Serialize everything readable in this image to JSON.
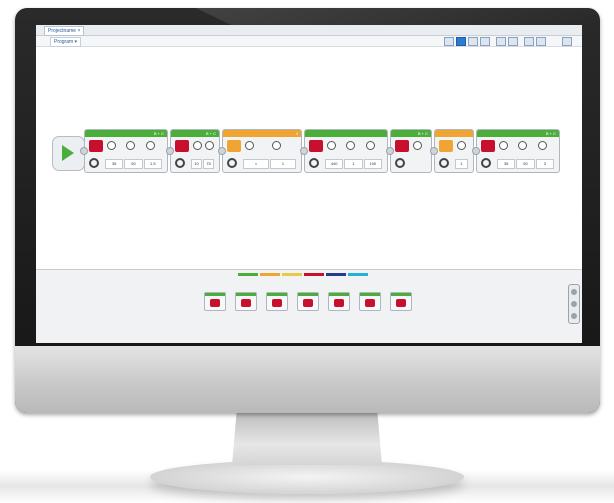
{
  "colors": {
    "action": "#4cae3a",
    "flow": "#f0a431",
    "sensor": "#e8c94a",
    "data": "#c8102e",
    "advanced": "#263b8c",
    "myblocks": "#27b0d6"
  },
  "titlebar": {
    "tab_label": "Projectname ×"
  },
  "program_bar": {
    "tab_label": "Program ▾",
    "project_name": ""
  },
  "blocks": [
    {
      "name": "move-steering",
      "category": "action",
      "port": "B + C",
      "icon": "motor-pair-icon",
      "params": [
        "35",
        "50",
        "1.5"
      ]
    },
    {
      "name": "move-tank",
      "category": "action",
      "port": "B + C",
      "icon": "motor-pair-icon",
      "params": [
        "10",
        "75"
      ]
    },
    {
      "name": "wait",
      "category": "flow",
      "port": "4",
      "icon": "hourglass-icon",
      "params": [
        "<",
        "1"
      ]
    },
    {
      "name": "sound",
      "category": "action",
      "port": "",
      "icon": "speaker-icon",
      "params": [
        "440",
        "1",
        "100"
      ]
    },
    {
      "name": "move-steering-2",
      "category": "action",
      "port": "B + C",
      "icon": "motor-pair-icon",
      "params": []
    },
    {
      "name": "wait-2",
      "category": "flow",
      "port": "",
      "icon": "hourglass-icon",
      "params": [
        "1"
      ]
    },
    {
      "name": "move-steering-3",
      "category": "action",
      "port": "B + C",
      "icon": "motor-pair-icon",
      "params": [
        "35",
        "50",
        "3"
      ]
    }
  ],
  "palette": {
    "tabs": [
      "action",
      "flow",
      "sensor",
      "data",
      "advanced",
      "myblocks"
    ],
    "items": [
      "medium-motor",
      "large-motor",
      "move-steering",
      "move-tank",
      "display",
      "sound",
      "brick-status-light"
    ]
  }
}
